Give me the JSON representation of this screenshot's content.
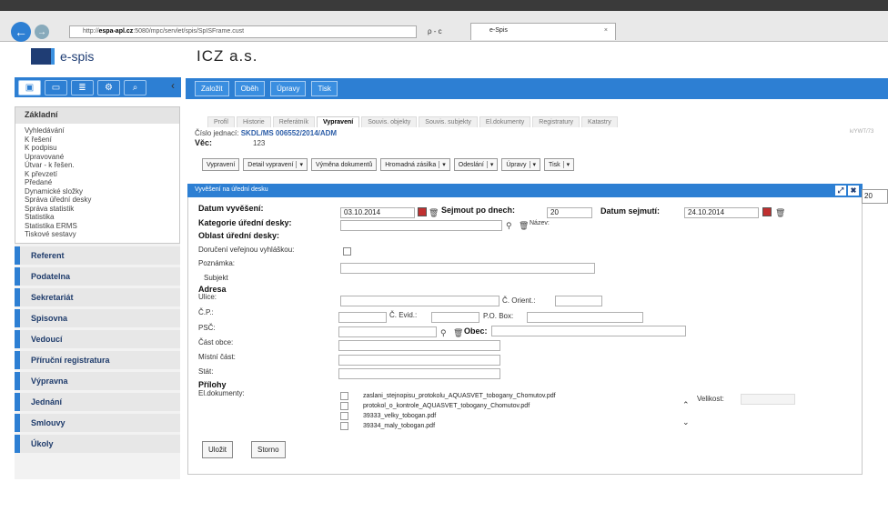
{
  "browser": {
    "address_prefix": "http://",
    "address_domain": "espa-apl.cz",
    "address_rest": ":5080/mpc/servlet/spis/SpISFrame.cust",
    "tab_title": "e-Spis",
    "search_glyph": "ρ - c"
  },
  "app": {
    "logo_text": "e-spis",
    "org_name": "ICZ a.s."
  },
  "toolbar": {
    "buttons": [
      "Založit",
      "Oběh",
      "Úpravy",
      "Tisk"
    ]
  },
  "sidebar": {
    "header": "Základní",
    "items": [
      "Vyhledávání",
      "K řešení",
      "K podpisu",
      "Upravované",
      "Útvar - k řešen.",
      "K převzetí",
      "Předané",
      "Dynamické složky",
      "Správa úřední desky",
      "Správa statistik",
      "Statistika",
      "Statistika ERMS",
      "Tiskové sestavy"
    ],
    "sections": [
      "Referent",
      "Podatelna",
      "Sekretariát",
      "Spisovna",
      "Vedoucí",
      "Příruční registratura",
      "Výpravna",
      "Jednání",
      "Smlouvy",
      "Úkoly"
    ]
  },
  "detail_tabs": [
    "Profil",
    "Historie",
    "Referátník",
    "Vypravení",
    "Souvis. objekty",
    "Souvis. subjekty",
    "El.dokumenty",
    "Registratury",
    "Katastry"
  ],
  "active_tab": "Vypravení",
  "doc": {
    "cj_label": "Číslo jednací:",
    "cj_value": "SKDL/MS 006552/2014/ADM",
    "vec_label": "Věc:",
    "vec_value": "123",
    "stamp": "k/YWT/73"
  },
  "actions": [
    {
      "label": "Vypravení",
      "dd": false
    },
    {
      "label": "Detail vypravení",
      "dd": true
    },
    {
      "label": "Výměna dokumentů",
      "dd": false
    },
    {
      "label": "Hromadná zásilka",
      "dd": true
    },
    {
      "label": "Odeslání",
      "dd": true
    },
    {
      "label": "Úpravy",
      "dd": true
    },
    {
      "label": "Tisk",
      "dd": true
    }
  ],
  "panel": {
    "title": "Vyvěšení na úřední desku",
    "page_size": "20"
  },
  "form": {
    "datum_vyveseni_label": "Datum vyvěšení:",
    "datum_vyveseni": "03.10.2014",
    "sejmout_label": "Sejmout po dnech:",
    "sejmout": "20",
    "datum_sejmuti_label": "Datum sejmutí:",
    "datum_sejmuti": "24.10.2014",
    "kategorie_label": "Kategorie úřední desky:",
    "nazev_label": "Název:",
    "oblast_label": "Oblast úřední desky:",
    "doruceni_label": "Doručení veřejnou vyhláškou:",
    "poznamka_label": "Poznámka:",
    "subjekt_label": "Subjekt",
    "adresa_label": "Adresa",
    "ulice_label": "Ulice:",
    "c_orient_label": "Č. Orient.:",
    "cp_label": "Č.P.:",
    "c_evid_label": "Č. Evid.:",
    "po_box_label": "P.O. Box:",
    "psc_label": "PSČ:",
    "obec_label": "Obec:",
    "cast_obce_label": "Část obce:",
    "mistni_cast_label": "Místní část:",
    "stat_label": "Stát:",
    "prilohy_label": "Přílohy",
    "el_dok_label": "El.dokumenty:",
    "velikost_label": "Velikost:",
    "files": [
      "zaslani_stejnopisu_protokolu_AQUASVET_tobogany_Chomutov.pdf",
      "protokol_o_kontrole_AQUASVET_tobogany_Chomutov.pdf",
      "39333_velky_tobogan.pdf",
      "39334_maly_tobogan.pdf"
    ],
    "save": "Uložit",
    "cancel": "Storno"
  }
}
